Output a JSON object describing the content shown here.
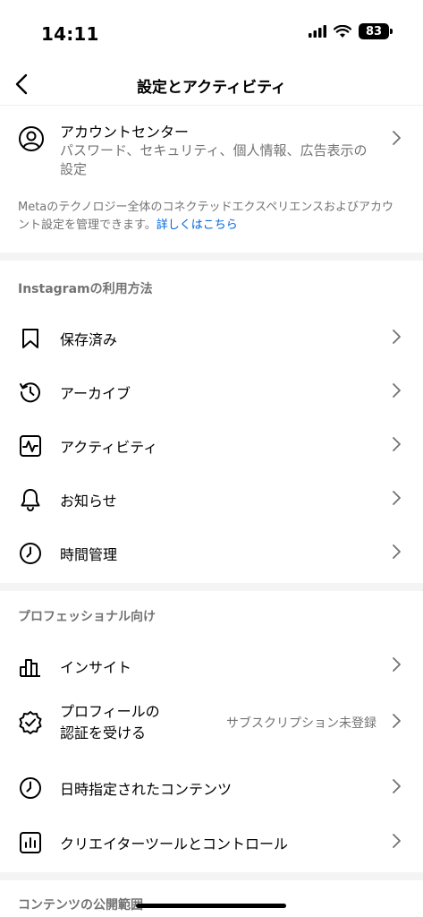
{
  "status": {
    "time": "14:11",
    "battery": "83"
  },
  "nav": {
    "title": "設定とアクティビティ"
  },
  "account": {
    "title": "アカウントセンター",
    "subtitle": "パスワード、セキュリティ、個人情報、広告表示の設定"
  },
  "meta_note": {
    "text": "Metaのテクノロジー全体のコネクテッドエクスペリエンスおよびアカウント設定を管理できます。",
    "link": "詳しくはこちら"
  },
  "sections": {
    "usage": {
      "header": "Instagramの利用方法",
      "items": [
        "保存済み",
        "アーカイブ",
        "アクティビティ",
        "お知らせ",
        "時間管理"
      ]
    },
    "professional": {
      "header": "プロフェッショナル向け",
      "insights": "インサイト",
      "verify_line1": "プロフィールの",
      "verify_line2": "認証を受ける",
      "verify_value": "サブスクリプション未登録",
      "scheduled": "日時指定されたコンテンツ",
      "creator_tools": "クリエイターツールとコントロール"
    },
    "visibility": {
      "header": "コンテンツの公開範囲"
    }
  },
  "icons": {
    "account": "person-circle-icon",
    "saved": "bookmark-icon",
    "archive": "archive-clock-icon",
    "activity": "activity-icon",
    "notifications": "bell-icon",
    "time": "clock-icon",
    "insights": "bar-chart-icon",
    "verify": "verified-badge-icon",
    "scheduled": "clock-icon",
    "creator": "chart-square-icon"
  }
}
